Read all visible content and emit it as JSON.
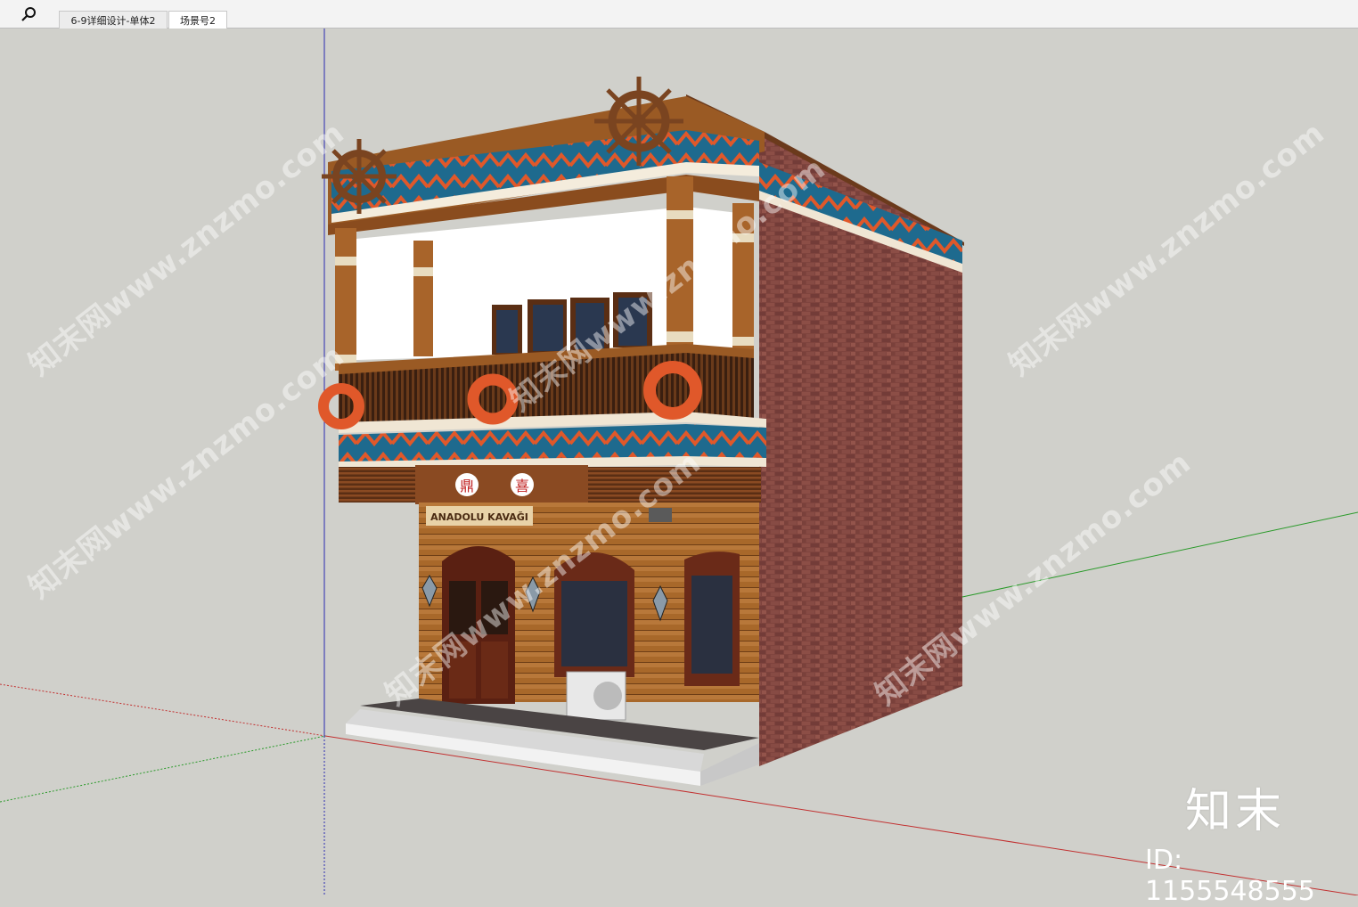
{
  "toolbar": {
    "search_icon": "search-icon"
  },
  "tabs": [
    {
      "label": "6-9详细设计-单体2",
      "active": false
    },
    {
      "label": "场景号2",
      "active": true
    }
  ],
  "storefront": {
    "sign_text": "ANADOLU KAVAĞI",
    "emblems": [
      "鼎",
      "喜"
    ]
  },
  "watermark": {
    "text": "知末网www.znzmo.com",
    "logo": "知末",
    "id_label": "ID: 1155548555"
  },
  "colors": {
    "background": "#d0d0cb",
    "brick": "#8e4e46",
    "wood": "#9a5a24",
    "band_blue": "#1e6a8e",
    "band_orange": "#e0582a",
    "axis_red": "#c23030",
    "axis_green": "#2a9a2a",
    "axis_blue": "#2a2ab0"
  }
}
